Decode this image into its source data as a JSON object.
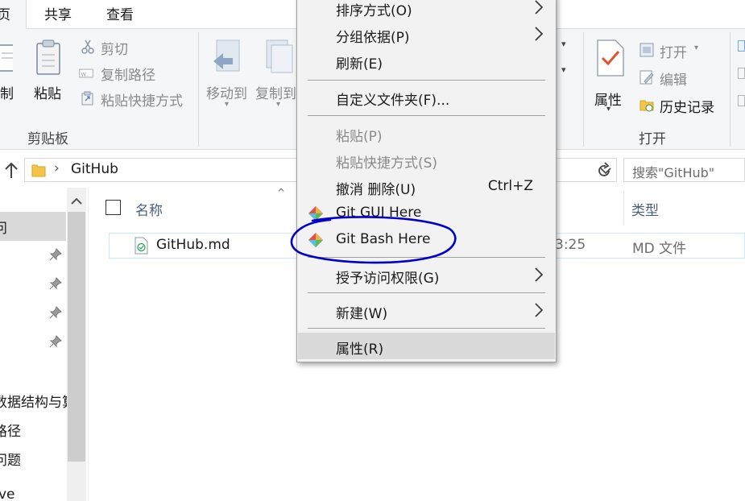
{
  "ribbon_tabs": [
    {
      "label": "页"
    },
    {
      "label": "共享"
    },
    {
      "label": "查看"
    }
  ],
  "clipboard": {
    "copy_label": "制",
    "paste_label": "粘贴",
    "cut_label": "剪切",
    "copy_path_label": "复制路径",
    "paste_shortcut_label": "粘贴快捷方式",
    "group_label": "剪贴板"
  },
  "organize": {
    "move_to_label": "移动到",
    "copy_to_label": "复制到"
  },
  "open": {
    "properties_label": "属性",
    "open_label": "打开",
    "edit_label": "编辑",
    "history_label": "历史记录",
    "group_label": "打开"
  },
  "address": {
    "path": "GitHub",
    "search_placeholder": "搜索\"GitHub\""
  },
  "nav_pane": {
    "items": [
      {
        "label": "问"
      },
      {
        "label": "数据结构与算"
      },
      {
        "label": "路径"
      },
      {
        "label": "问题"
      },
      {
        "label": "ve"
      }
    ]
  },
  "file_list": {
    "columns": [
      {
        "label": "名称"
      },
      {
        "label": "类型"
      }
    ],
    "rows": [
      {
        "name": "GitHub.md",
        "modified": "3:25",
        "type": "MD 文件"
      }
    ]
  },
  "context_menu": {
    "items": [
      {
        "label": "排序方式(O)"
      },
      {
        "label": "分组依据(P)"
      },
      {
        "label": "刷新(E)"
      },
      {
        "label": "自定义文件夹(F)..."
      },
      {
        "label": "粘贴(P)"
      },
      {
        "label": "粘贴快捷方式(S)"
      },
      {
        "label": "撤消 删除(U)",
        "shortcut": "Ctrl+Z"
      },
      {
        "label": "Git GUI Here"
      },
      {
        "label": "Git Bash Here"
      },
      {
        "label": "授予访问权限(G)"
      },
      {
        "label": "新建(W)"
      },
      {
        "label": "属性(R)"
      }
    ]
  },
  "colors": {
    "annotation": "#0000cc",
    "selection_border": "#cce8ff",
    "ribbon_bg": "#f5f6f7",
    "menu_bg": "#f2f2f2"
  }
}
